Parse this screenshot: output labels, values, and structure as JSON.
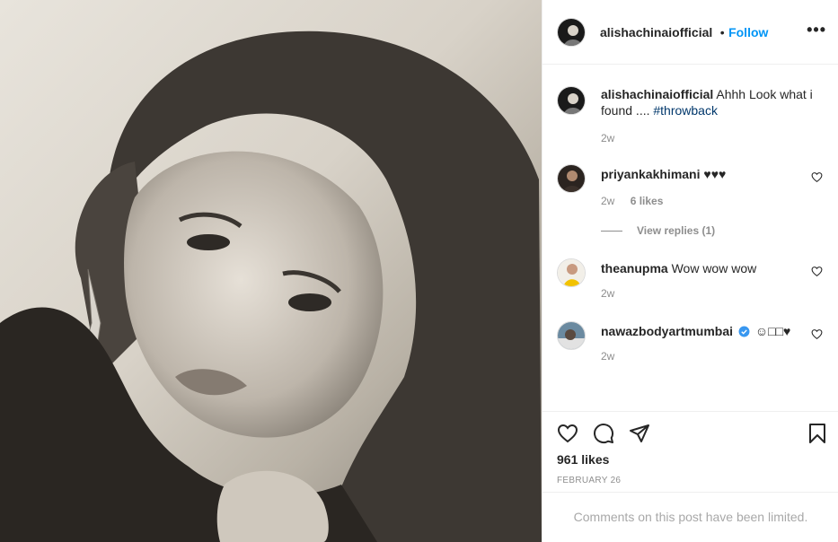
{
  "post": {
    "username": "alishachinaiofficial",
    "follow_label": "Follow",
    "dot": "•",
    "more": "•••",
    "photo_alt": "Black and white portrait",
    "caption": {
      "username": "alishachinaiofficial",
      "text": "Ahhh Look what i found ....",
      "hashtag": "#throwback",
      "time": "2w"
    },
    "comments": [
      {
        "username": "priyankakhimani",
        "text": "♥♥♥",
        "time": "2w",
        "likes": "6 likes",
        "view_replies": "View replies (1)"
      },
      {
        "username": "theanupma",
        "text": "Wow wow wow",
        "time": "2w"
      },
      {
        "username": "nawazbodyartmumbai",
        "text": "☺□□♥",
        "time": "2w"
      }
    ],
    "likes": "961 likes",
    "date": "FEBRUARY 26",
    "limited_notice": "Comments on this post have been limited."
  },
  "colors": {
    "accent": "#0095f6",
    "verified": "#3897f0",
    "muted": "#8e8e8e"
  },
  "icons": [
    "heart-icon",
    "comment-icon",
    "share-icon",
    "bookmark-icon",
    "more-icon",
    "verified-badge-icon"
  ]
}
